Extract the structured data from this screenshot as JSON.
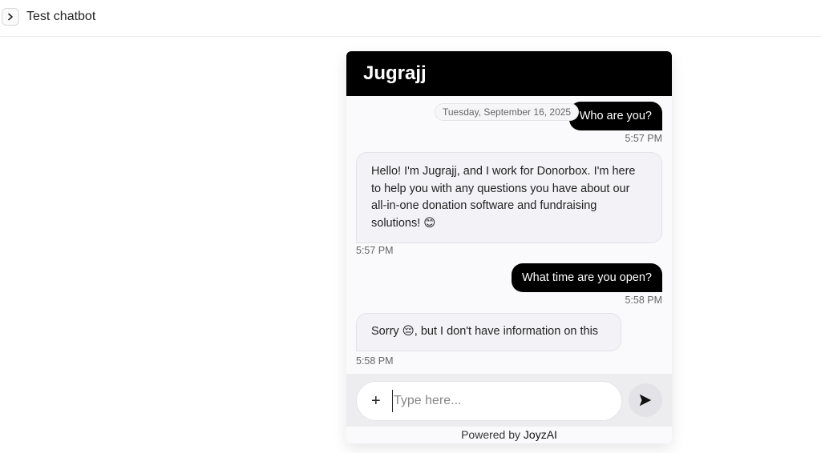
{
  "topbar": {
    "toggle_icon": "chevron-right-icon",
    "title": "Test chatbot"
  },
  "widget": {
    "bot_name": "Jugrajj",
    "date_separator": "Tuesday, September 16, 2025",
    "messages": [
      {
        "role": "user",
        "text": "Who are you?",
        "time": "5:57 PM"
      },
      {
        "role": "bot",
        "text": "Hello! I'm Jugrajj, and I work for Donorbox. I'm here to help you with any questions you have about our all-in-one donation software and fundraising solutions! 😊",
        "time": "5:57 PM"
      },
      {
        "role": "user",
        "text": "What time are you open?",
        "time": "5:58 PM"
      },
      {
        "role": "bot",
        "text": "Sorry 😔, but I don't have information on this",
        "time": "5:58 PM"
      }
    ],
    "composer": {
      "attach_icon": "plus-icon",
      "placeholder": "Type here...",
      "send_icon": "send-icon"
    },
    "footer": {
      "prefix": "Powered by",
      "brand": "JoyzAI"
    }
  }
}
